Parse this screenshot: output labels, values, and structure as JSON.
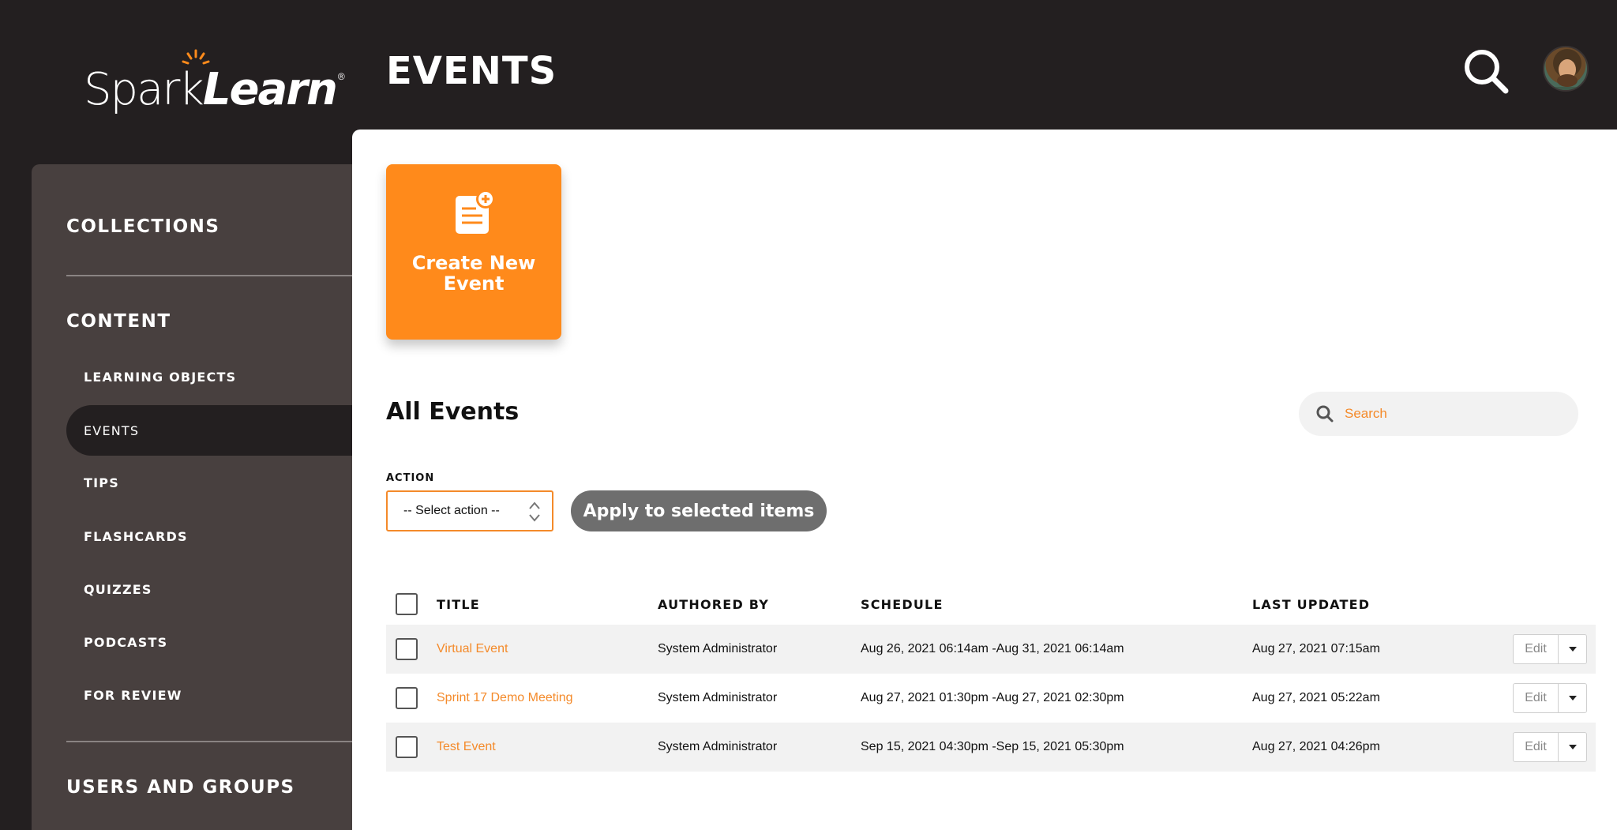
{
  "header": {
    "logo_text_light": "Spark",
    "logo_text_bold": "Learn",
    "logo_reg": "®",
    "page_title": "EVENTS"
  },
  "sidebar": {
    "sections": [
      {
        "label": "COLLECTIONS"
      },
      {
        "label": "CONTENT"
      },
      {
        "label": "USERS AND GROUPS"
      }
    ],
    "content_items": [
      {
        "label": "LEARNING OBJECTS",
        "active": false
      },
      {
        "label": "EVENTS",
        "active": true
      },
      {
        "label": "TIPS",
        "active": false
      },
      {
        "label": "FLASHCARDS",
        "active": false
      },
      {
        "label": "QUIZZES",
        "active": false
      },
      {
        "label": "PODCASTS",
        "active": false
      },
      {
        "label": "FOR REVIEW",
        "active": false
      }
    ]
  },
  "main": {
    "create_card_label": "Create New Event",
    "section_title": "All Events",
    "search_placeholder": "Search",
    "action_label": "ACTION",
    "action_select_value": "-- Select action --",
    "apply_button": "Apply to selected items"
  },
  "table": {
    "headers": [
      "TITLE",
      "AUTHORED BY",
      "SCHEDULE",
      "LAST UPDATED"
    ],
    "edit_label": "Edit",
    "rows": [
      {
        "title": "Virtual Event",
        "author": "System Administrator",
        "schedule": "Aug 26, 2021 06:14am -Aug 31, 2021 06:14am",
        "updated": "Aug 27, 2021 07:15am"
      },
      {
        "title": "Sprint 17 Demo Meeting",
        "author": "System Administrator",
        "schedule": "Aug 27, 2021 01:30pm -Aug 27, 2021 02:30pm",
        "updated": "Aug 27, 2021 05:22am"
      },
      {
        "title": "Test Event",
        "author": "System Administrator",
        "schedule": "Sep 15, 2021 04:30pm -Sep 15, 2021 05:30pm",
        "updated": "Aug 27, 2021 04:26pm"
      }
    ]
  },
  "colors": {
    "accent": "#ff8a1b",
    "header_bg": "#231f20",
    "sidebar_bg": "#48403f",
    "link": "#f48a2a"
  },
  "icons": [
    "sparkle-icon",
    "search-icon",
    "avatar",
    "add-document-icon",
    "select-arrows-icon",
    "chevron-down-icon"
  ]
}
